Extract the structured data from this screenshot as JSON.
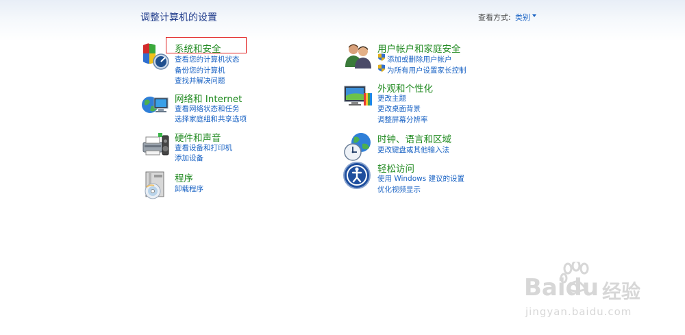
{
  "header": {
    "title": "调整计算机的设置",
    "view_by_label": "查看方式:",
    "view_by_value": "类别"
  },
  "categories_left": [
    {
      "title": "系统和安全",
      "icon": "system-security-icon",
      "links": [
        "查看您的计算机状态",
        "备份您的计算机",
        "查找并解决问题"
      ]
    },
    {
      "title": "网络和 Internet",
      "icon": "network-internet-icon",
      "links": [
        "查看网络状态和任务",
        "选择家庭组和共享选项"
      ]
    },
    {
      "title": "硬件和声音",
      "icon": "hardware-sound-icon",
      "links": [
        "查看设备和打印机",
        "添加设备"
      ]
    },
    {
      "title": "程序",
      "icon": "programs-icon",
      "links": [
        "卸载程序"
      ]
    }
  ],
  "categories_right": [
    {
      "title": "用户帐户和家庭安全",
      "icon": "user-accounts-icon",
      "links": [
        "添加或删除用户帐户",
        "为所有用户设置家长控制"
      ]
    },
    {
      "title": "外观和个性化",
      "icon": "appearance-icon",
      "links": [
        "更改主题",
        "更改桌面背景",
        "调整屏幕分辨率"
      ]
    },
    {
      "title": "时钟、语言和区域",
      "icon": "clock-language-icon",
      "links": [
        "更改键盘或其他输入法"
      ]
    },
    {
      "title": "轻松访问",
      "icon": "ease-of-access-icon",
      "links": [
        "使用 Windows 建议的设置",
        "优化视频显示"
      ]
    }
  ],
  "watermark": {
    "brand": "Baidu",
    "brand_cn": "经验",
    "url": "jingyan.baidu.com"
  }
}
